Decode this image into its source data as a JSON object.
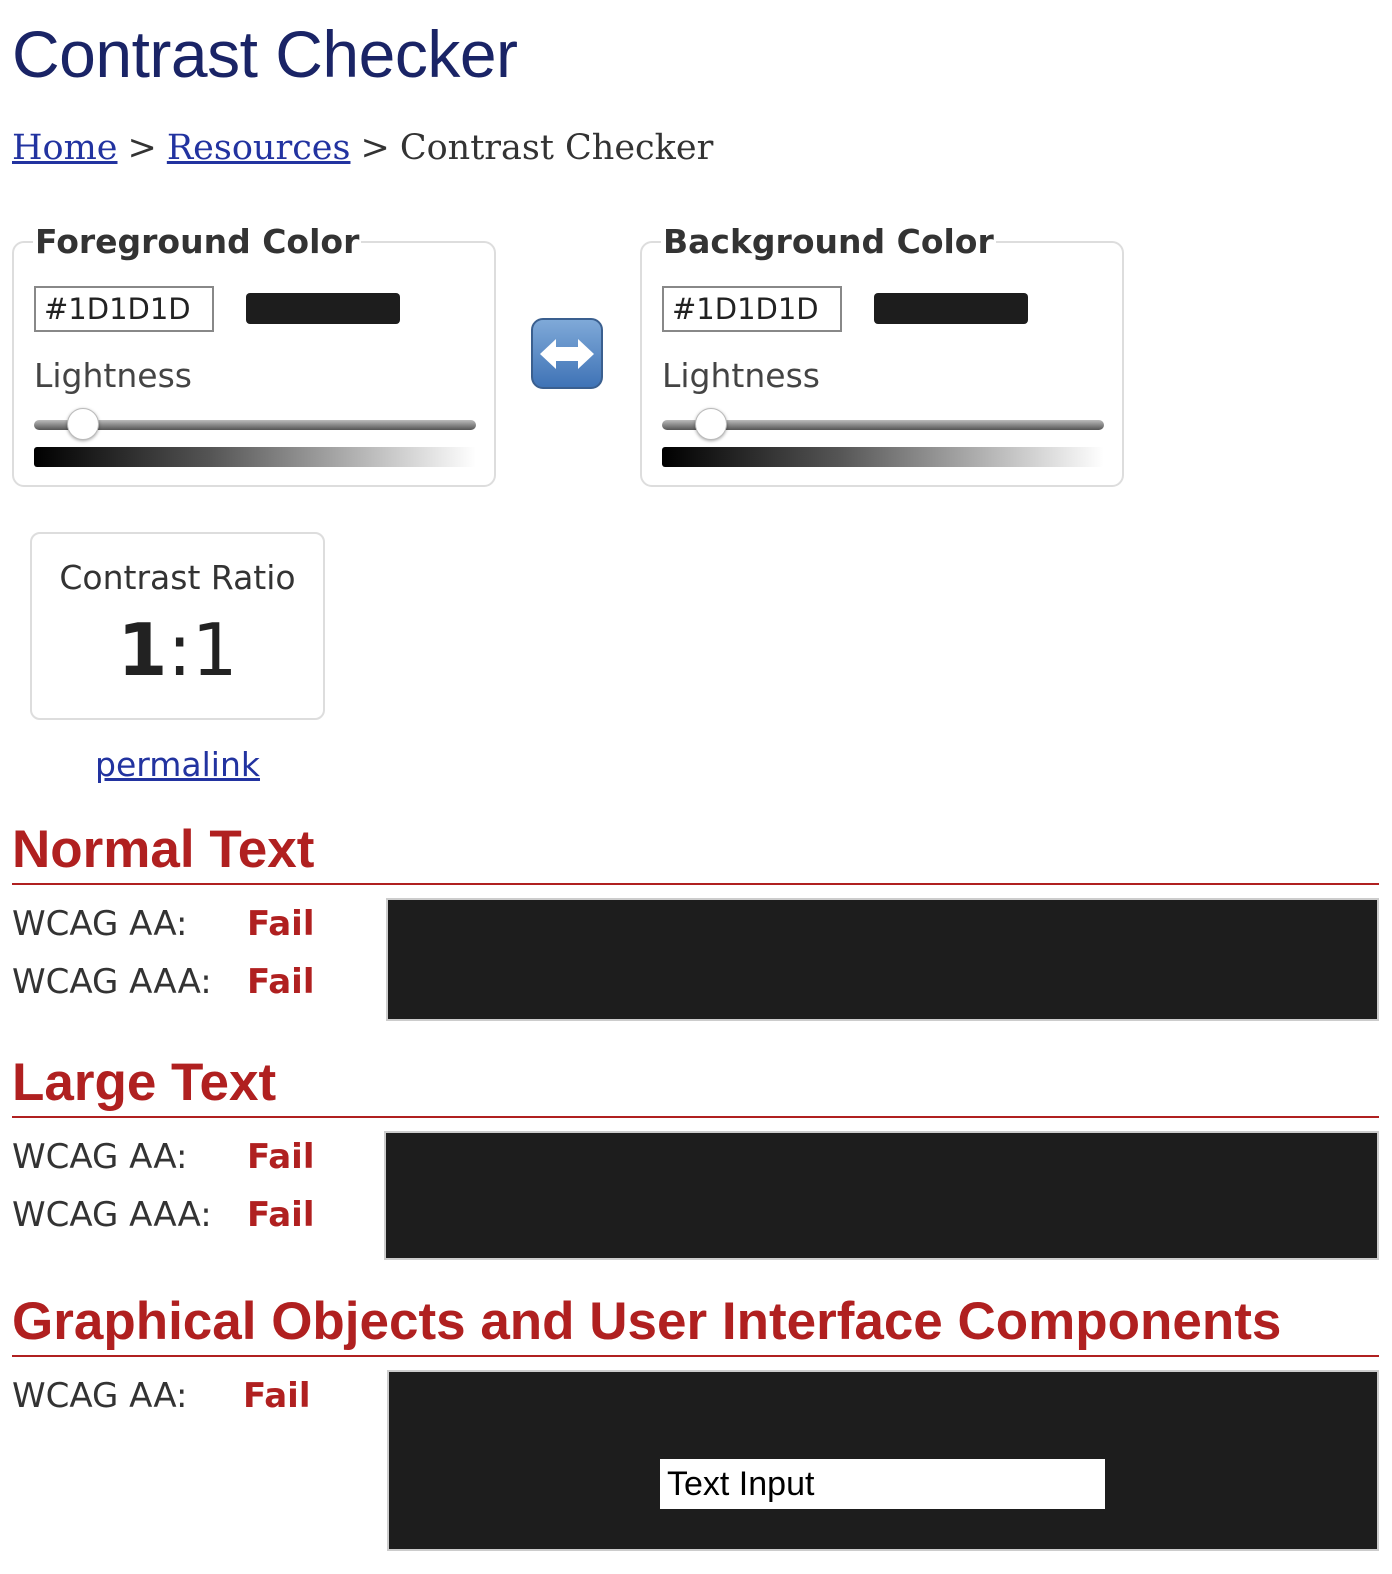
{
  "page": {
    "title": "Contrast Checker"
  },
  "breadcrumb": {
    "home": "Home",
    "separator": ">",
    "resources": "Resources",
    "current": "Contrast Checker"
  },
  "foreground": {
    "legend": "Foreground Color",
    "hex_value": "#1D1D1D",
    "swatch_color": "#1d1d1d",
    "lightness_label": "Lightness",
    "lightness_level": 0.11
  },
  "background": {
    "legend": "Background Color",
    "hex_value": "#1D1D1D",
    "swatch_color": "#1d1d1d",
    "lightness_label": "Lightness",
    "lightness_level": 0.11
  },
  "swap": {
    "icon": "left-right-arrow-icon"
  },
  "contrast": {
    "label": "Contrast Ratio",
    "ratio_left": "1",
    "ratio_sep": ":",
    "ratio_right": "1",
    "permalink": "permalink"
  },
  "normal_text": {
    "heading": "Normal Text",
    "aa_label": "WCAG AA:",
    "aa_result": "Fail",
    "aaa_label": "WCAG AAA:",
    "aaa_result": "Fail"
  },
  "large_text": {
    "heading": "Large Text",
    "aa_label": "WCAG AA:",
    "aa_result": "Fail",
    "aaa_label": "WCAG AAA:",
    "aaa_result": "Fail"
  },
  "graphical": {
    "heading": "Graphical Objects and User Interface Components",
    "aa_label": "WCAG AA:",
    "aa_result": "Fail",
    "input_value": "Text Input"
  },
  "colors": {
    "title": "#1a2466",
    "link": "#2233a0",
    "section_red": "#b02020",
    "preview_bg": "#1d1d1d"
  }
}
